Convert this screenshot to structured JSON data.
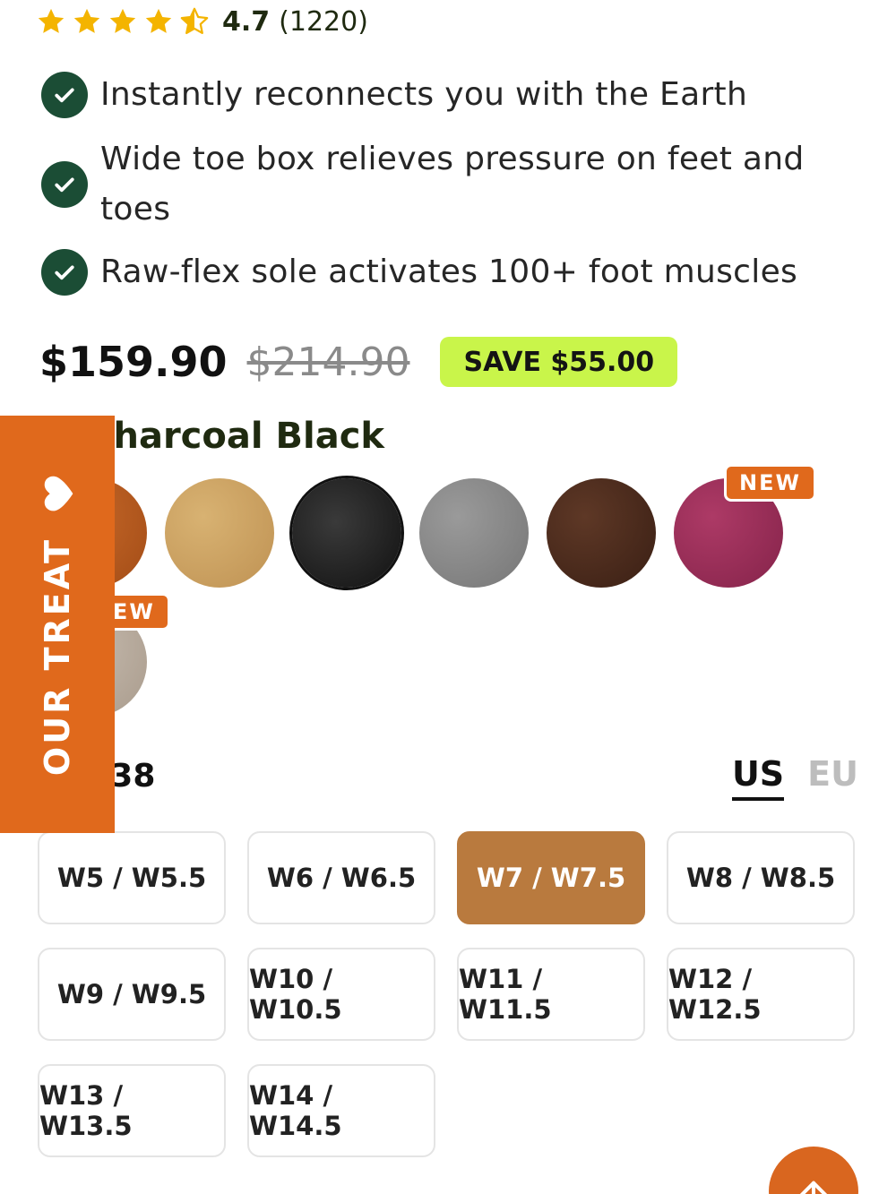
{
  "rating": {
    "stars": 4.5,
    "score": "4.7",
    "count": "(1220)",
    "star_color": "#f4b400"
  },
  "features": [
    {
      "icon": "check-circle-icon",
      "lines": [
        "Instantly reconnects you with the Earth"
      ]
    },
    {
      "icon": "check-circle-icon",
      "lines": [
        "Wide toe box relieves pressure on feet and",
        "toes"
      ]
    },
    {
      "icon": "check-circle-icon",
      "lines": [
        "Raw-flex sole activates 100+ foot muscles"
      ]
    }
  ],
  "price": {
    "current": "$159.90",
    "compare_at": "$214.90",
    "save_label": "SAVE $55.00",
    "save_color": "#c9f54a"
  },
  "color": {
    "label": "or: Charcoal Black",
    "swatches": [
      {
        "name": "cognac",
        "color": "#b5561b",
        "selected": false
      },
      {
        "name": "tan",
        "color": "#caa062",
        "selected": false
      },
      {
        "name": "charcoal-black",
        "color": "#1c1c1c",
        "selected": true
      },
      {
        "name": "grey",
        "color": "#8a8a8a",
        "selected": false
      },
      {
        "name": "dark-brown",
        "color": "#4a2a1c",
        "selected": false
      },
      {
        "name": "burgundy",
        "color": "#9a2d55",
        "selected": false,
        "badge": "NEW"
      },
      {
        "name": "taupe",
        "color": "#b9ad9f",
        "selected": false,
        "badge": "IEW"
      }
    ]
  },
  "size": {
    "label": ": EU 38",
    "units": [
      {
        "label": "US",
        "active": true
      },
      {
        "label": "EU",
        "active": false
      }
    ],
    "options": [
      {
        "label": "W5 / W5.5",
        "selected": false
      },
      {
        "label": "W6 / W6.5",
        "selected": false
      },
      {
        "label": "W7 / W7.5",
        "selected": true
      },
      {
        "label": "W8 / W8.5",
        "selected": false
      },
      {
        "label": "W9 / W9.5",
        "selected": false
      },
      {
        "label": "W10 / W10.5",
        "selected": false
      },
      {
        "label": "W11 / W11.5",
        "selected": false
      },
      {
        "label": "W12 / W12.5",
        "selected": false
      },
      {
        "label": "W13 / W13.5",
        "selected": false
      },
      {
        "label": "W14 / W14.5",
        "selected": false
      }
    ]
  },
  "treat_tab": {
    "label": "OUR TREAT",
    "icon": "heart-icon",
    "color": "#e0691c"
  },
  "scroll_top": {
    "icon": "arrow-up-icon",
    "color": "#d9661f"
  }
}
